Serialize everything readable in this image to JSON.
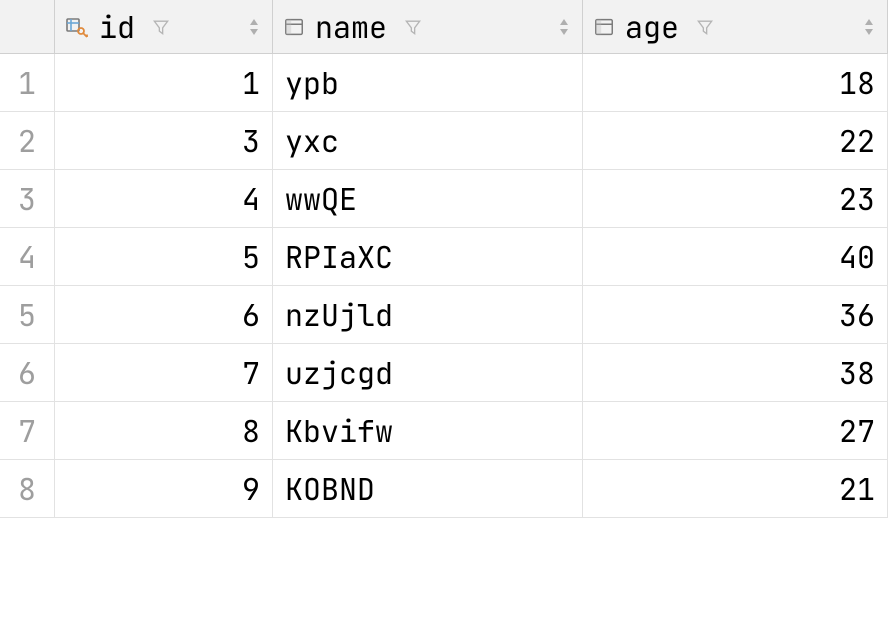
{
  "columns": [
    {
      "key": "id",
      "label": "id",
      "type": "pk"
    },
    {
      "key": "name",
      "label": "name",
      "type": "column"
    },
    {
      "key": "age",
      "label": "age",
      "type": "column"
    }
  ],
  "rows": [
    {
      "n": "1",
      "id": "1",
      "name": "ypb",
      "age": "18"
    },
    {
      "n": "2",
      "id": "3",
      "name": "yxc",
      "age": "22"
    },
    {
      "n": "3",
      "id": "4",
      "name": "wwQE",
      "age": "23"
    },
    {
      "n": "4",
      "id": "5",
      "name": "RPIaXC",
      "age": "40"
    },
    {
      "n": "5",
      "id": "6",
      "name": "nzUjld",
      "age": "36"
    },
    {
      "n": "6",
      "id": "7",
      "name": "uzjcgd",
      "age": "38"
    },
    {
      "n": "7",
      "id": "8",
      "name": "Kbvifw",
      "age": "27"
    },
    {
      "n": "8",
      "id": "9",
      "name": "KOBND",
      "age": "21"
    }
  ]
}
